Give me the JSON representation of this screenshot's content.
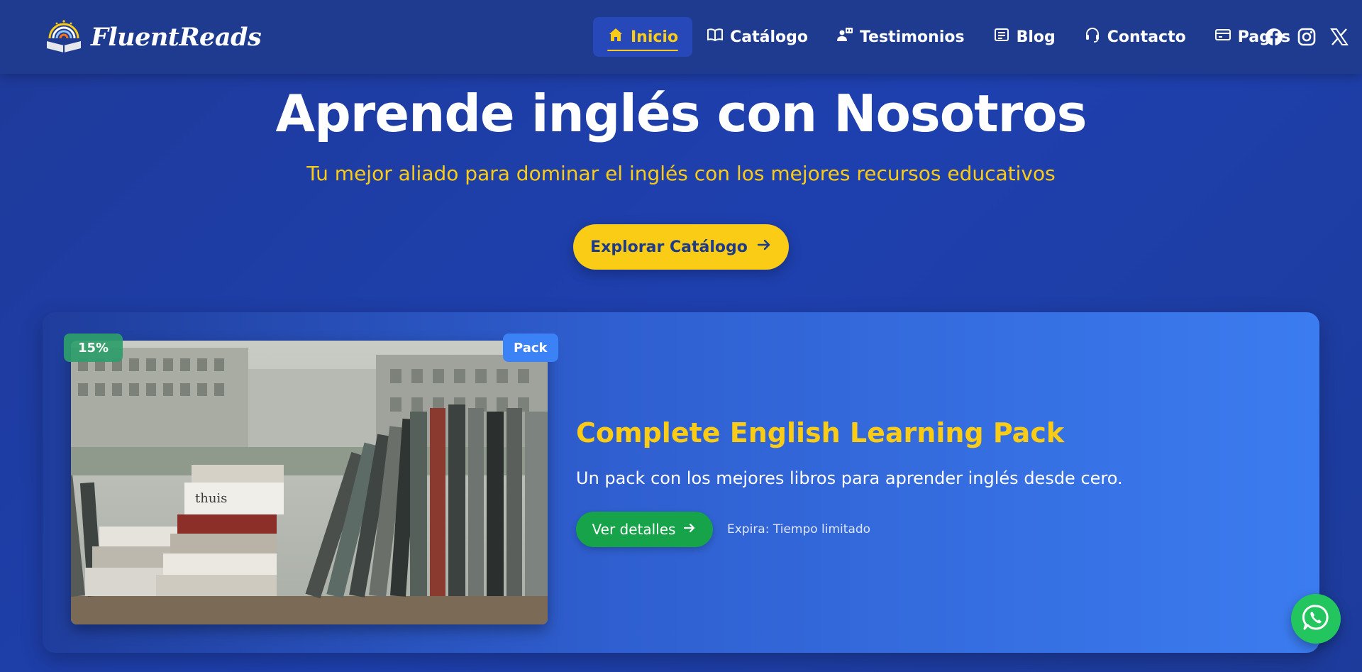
{
  "brand": {
    "name": "FluentReads",
    "logo_icon": "book-rainbow-icon"
  },
  "nav": {
    "items": [
      {
        "label": "Inicio",
        "icon": "home-icon",
        "active": true
      },
      {
        "label": "Catálogo",
        "icon": "book-open-icon",
        "active": false
      },
      {
        "label": "Testimonios",
        "icon": "user-quote-icon",
        "active": false
      },
      {
        "label": "Blog",
        "icon": "news-icon",
        "active": false
      },
      {
        "label": "Contacto",
        "icon": "headset-icon",
        "active": false
      },
      {
        "label": "Pagos",
        "icon": "credit-card-icon",
        "active": false
      }
    ],
    "socials": [
      "facebook-icon",
      "instagram-icon",
      "x-icon"
    ]
  },
  "hero": {
    "title": "Aprende inglés con Nosotros",
    "subtitle": "Tu mejor aliado para dominar el inglés con los mejores recursos educativos",
    "cta_label": "Explorar Catálogo"
  },
  "promo": {
    "discount_badge": "15%",
    "type_badge": "Pack",
    "image_text": "thuis",
    "title": "Complete English Learning Pack",
    "description": "Un pack con los mejores libros para aprender inglés desde cero.",
    "details_label": "Ver detalles",
    "expiry": "Expira: Tiempo limitado"
  },
  "floating": {
    "whatsapp_icon": "whatsapp-icon"
  },
  "colors": {
    "primary": "#1e40af",
    "header": "#1f3b8f",
    "accent_yellow": "#facc15",
    "green": "#16a34a",
    "badge_blue": "#3b82f6"
  }
}
